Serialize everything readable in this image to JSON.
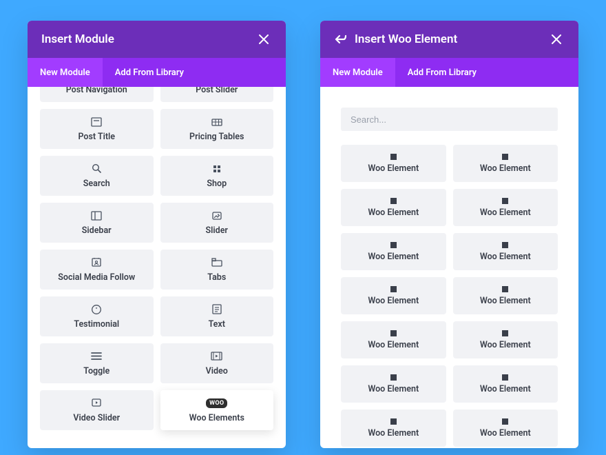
{
  "left_panel": {
    "title": "Insert Module",
    "tabs": {
      "new_module": "New Module",
      "add_from_library": "Add From Library"
    },
    "modules": [
      {
        "id": "post-navigation",
        "label": "Post Navigation"
      },
      {
        "id": "post-slider",
        "label": "Post Slider"
      },
      {
        "id": "post-title",
        "label": "Post Title"
      },
      {
        "id": "pricing-tables",
        "label": "Pricing Tables"
      },
      {
        "id": "search",
        "label": "Search"
      },
      {
        "id": "shop",
        "label": "Shop"
      },
      {
        "id": "sidebar",
        "label": "Sidebar"
      },
      {
        "id": "slider",
        "label": "Slider"
      },
      {
        "id": "social-media-follow",
        "label": "Social Media Follow"
      },
      {
        "id": "tabs",
        "label": "Tabs"
      },
      {
        "id": "testimonial",
        "label": "Testimonial"
      },
      {
        "id": "text",
        "label": "Text"
      },
      {
        "id": "toggle",
        "label": "Toggle"
      },
      {
        "id": "video",
        "label": "Video"
      },
      {
        "id": "video-slider",
        "label": "Video Slider"
      },
      {
        "id": "woo-elements",
        "label": "Woo Elements",
        "highlight": true,
        "badge": "WOO"
      }
    ]
  },
  "right_panel": {
    "title": "Insert Woo Element",
    "tabs": {
      "new_module": "New Module",
      "add_from_library": "Add From Library"
    },
    "search_placeholder": "Search...",
    "item_label": "Woo Element",
    "item_count": 14
  }
}
